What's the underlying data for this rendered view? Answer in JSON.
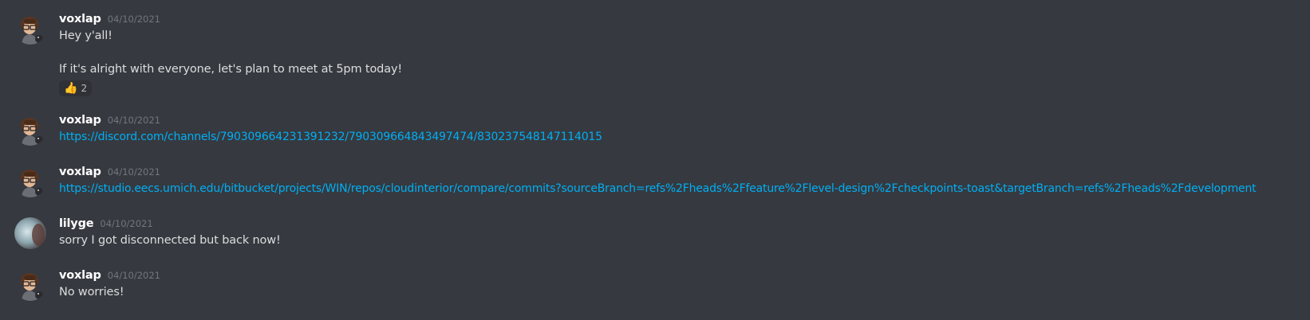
{
  "messages": [
    {
      "username": "voxlap",
      "timestamp": "04/10/2021",
      "lines": [
        "Hey y'all!",
        "If it's alright with everyone, let's plan to meet at 5pm today!"
      ],
      "reaction": {
        "emoji": "👍",
        "count": "2"
      }
    },
    {
      "username": "voxlap",
      "timestamp": "04/10/2021",
      "link": "https://discord.com/channels/790309664231391232/790309664843497474/830237548147114015"
    },
    {
      "username": "voxlap",
      "timestamp": "04/10/2021",
      "link": "https://studio.eecs.umich.edu/bitbucket/projects/WIN/repos/cloudinterior/compare/commits?sourceBranch=refs%2Fheads%2Ffeature%2Flevel-design%2Fcheckpoints-toast&targetBranch=refs%2Fheads%2Fdevelopment"
    },
    {
      "username": "lilyge",
      "timestamp": "04/10/2021",
      "lines": [
        "sorry I got disconnected but back now!"
      ]
    },
    {
      "username": "voxlap",
      "timestamp": "04/10/2021",
      "lines": [
        "No worries!"
      ]
    }
  ],
  "colors": {
    "background": "#36393f",
    "username": "#ffffff",
    "timestamp": "#72767d",
    "text": "#dcddde",
    "link": "#00aff4"
  }
}
